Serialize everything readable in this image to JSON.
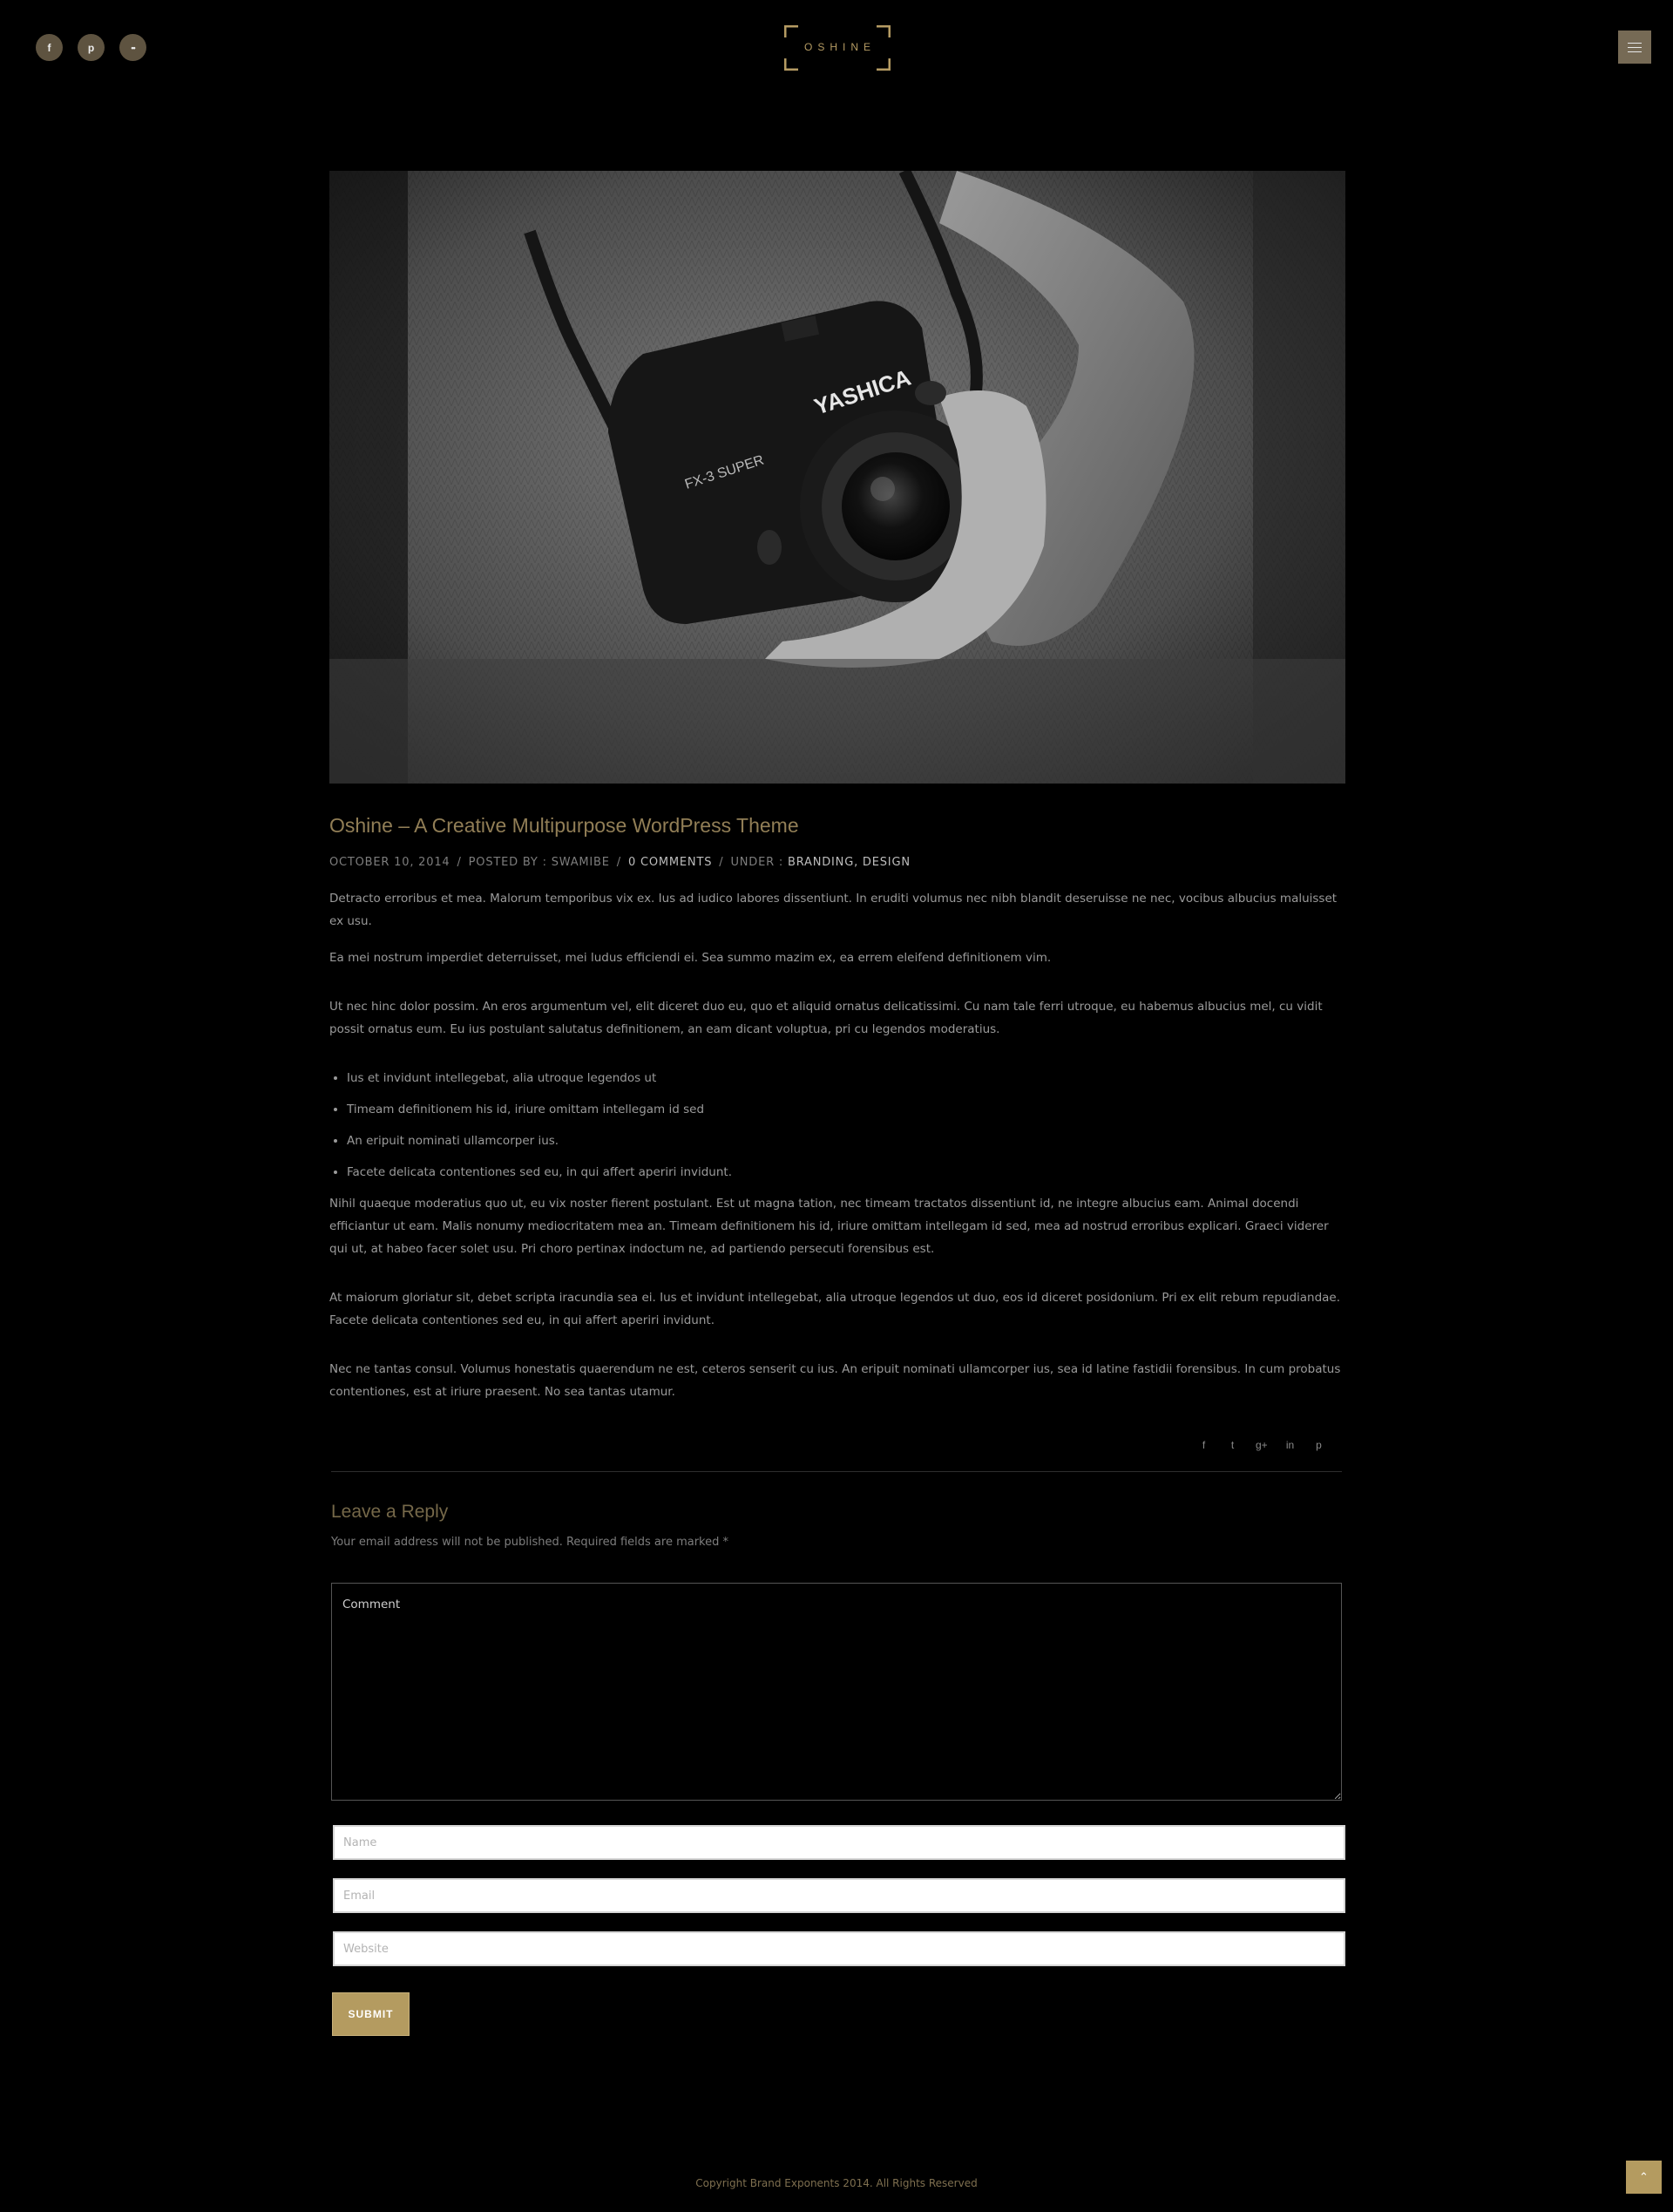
{
  "header": {
    "social": [
      {
        "icon": "facebook-icon",
        "glyph": "f"
      },
      {
        "icon": "pinterest-icon",
        "glyph": "p"
      },
      {
        "icon": "flickr-icon",
        "glyph": "••"
      }
    ],
    "logo_text": "OSHINE"
  },
  "post": {
    "title": "Oshine – A Creative Multipurpose WordPress Theme",
    "meta": {
      "date": "OCTOBER 10, 2014",
      "posted_by_label": "POSTED BY :",
      "author": "SWAMIBE",
      "comments": "0 COMMENTS",
      "under_label": "UNDER :",
      "categories": "BRANDING, DESIGN"
    },
    "paragraphs": [
      "Detracto erroribus et mea. Malorum temporibus vix ex. Ius ad iudico labores dissentiunt. In eruditi volumus nec nibh blandit deseruisse ne nec, vocibus albucius maluisset ex usu.",
      "Ea mei nostrum imperdiet deterruisset, mei ludus efficiendi ei. Sea summo mazim ex, ea errem eleifend definitionem vim.",
      "Ut nec hinc dolor possim. An eros argumentum vel, elit diceret duo eu, quo et aliquid ornatus delicatissimi. Cu nam tale ferri utroque, eu habemus albucius mel, cu vidit possit ornatus eum. Eu ius postulant salutatus definitionem, an eam dicant voluptua, pri cu legendos moderatius."
    ],
    "list": [
      "Ius et invidunt intellegebat, alia utroque legendos ut",
      "Timeam definitionem his id, iriure omittam intellegam id sed",
      "An eripuit nominati ullamcorper ius.",
      "Facete delicata contentiones sed eu, in qui affert aperiri invidunt."
    ],
    "paragraphs_after": [
      "Nihil quaeque moderatius quo ut, eu vix noster fierent postulant. Est ut magna tation, nec timeam tractatos dissentiunt id, ne integre albucius eam. Animal docendi efficiantur ut eam. Malis nonumy mediocritatem mea an. Timeam definitionem his id, iriure omittam intellegam id sed, mea ad nostrud erroribus explicari. Graeci viderer qui ut, at habeo facer solet usu. Pri choro pertinax indoctum ne, ad partiendo persecuti forensibus est.",
      "At maiorum gloriatur sit, debet scripta iracundia sea ei. Ius et invidunt intellegebat, alia utroque legendos ut duo, eos id diceret posidonium. Pri ex elit rebum repudiandae. Facete delicata contentiones sed eu, in qui affert aperiri invidunt.",
      "Nec ne tantas consul. Volumus honestatis quaerendum ne est, ceteros senserit cu ius. An eripuit nominati ullamcorper ius, sea id latine fastidii forensibus. In cum probatus contentiones, est at iriure praesent. No sea tantas utamur."
    ],
    "share_icons": [
      {
        "icon": "facebook-share-icon",
        "glyph": "f"
      },
      {
        "icon": "twitter-share-icon",
        "glyph": "t"
      },
      {
        "icon": "google-plus-share-icon",
        "glyph": "g+"
      },
      {
        "icon": "linkedin-share-icon",
        "glyph": "in"
      },
      {
        "icon": "pinterest-share-icon",
        "glyph": "p"
      }
    ]
  },
  "reply": {
    "title": "Leave a Reply",
    "note": "Your email address will not be published. Required fields are marked",
    "required_mark": "*",
    "comment_placeholder": "Comment",
    "name_placeholder": "Name",
    "email_placeholder": "Email",
    "website_placeholder": "Website",
    "submit_label": "SUBMIT"
  },
  "footer": {
    "copyright": "Copyright Brand Exponents 2014. All Rights Reserved"
  },
  "colors": {
    "accent": "#b49b60",
    "title": "#917e56",
    "background": "#000000"
  }
}
